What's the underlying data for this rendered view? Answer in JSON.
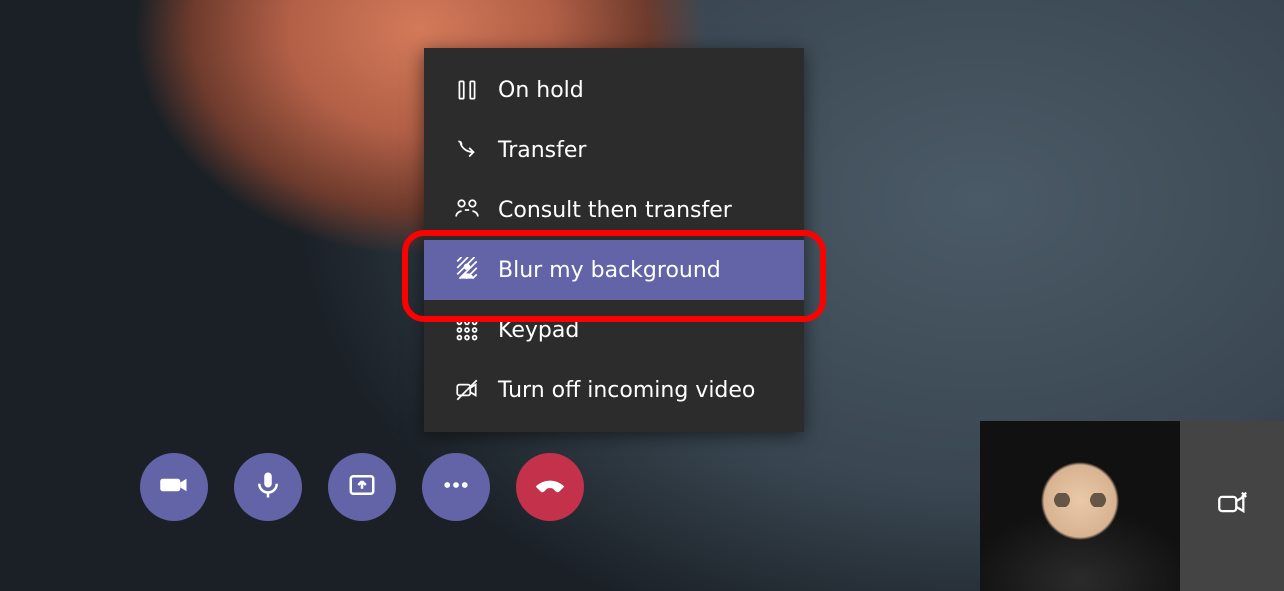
{
  "menu": {
    "items": [
      {
        "label": "On hold",
        "icon": "pause-icon",
        "selected": false
      },
      {
        "label": "Transfer",
        "icon": "transfer-icon",
        "selected": false
      },
      {
        "label": "Consult then transfer",
        "icon": "consult-transfer-icon",
        "selected": false
      },
      {
        "label": "Blur my background",
        "icon": "blur-background-icon",
        "selected": true
      },
      {
        "label": "Keypad",
        "icon": "keypad-icon",
        "selected": false
      },
      {
        "label": "Turn off incoming video",
        "icon": "video-off-icon",
        "selected": false
      }
    ]
  },
  "toolbar": {
    "camera": {
      "name": "camera-button"
    },
    "mic": {
      "name": "microphone-button"
    },
    "share": {
      "name": "share-screen-button"
    },
    "more": {
      "name": "more-actions-button"
    },
    "hangup": {
      "name": "hangup-button"
    }
  },
  "self_view": {
    "popout_name": "popout-video-button"
  },
  "colors": {
    "accent": "#6264a7",
    "danger": "#c4314b",
    "menu_bg": "#2d2c2c",
    "highlight": "#ff0000"
  }
}
